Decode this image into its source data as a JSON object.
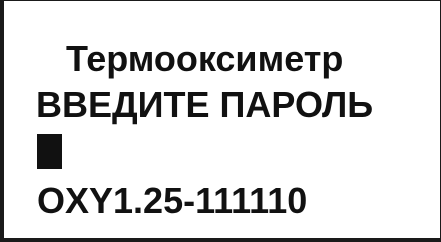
{
  "screen": {
    "title": "Термооксиметр",
    "prompt": "ВВЕДИТЕ ПАРОЛЬ",
    "password_value": "",
    "version": "OXY1.25-111110"
  },
  "colors": {
    "background": "#ffffff",
    "text": "#111111",
    "border": "#1a1a1a"
  }
}
